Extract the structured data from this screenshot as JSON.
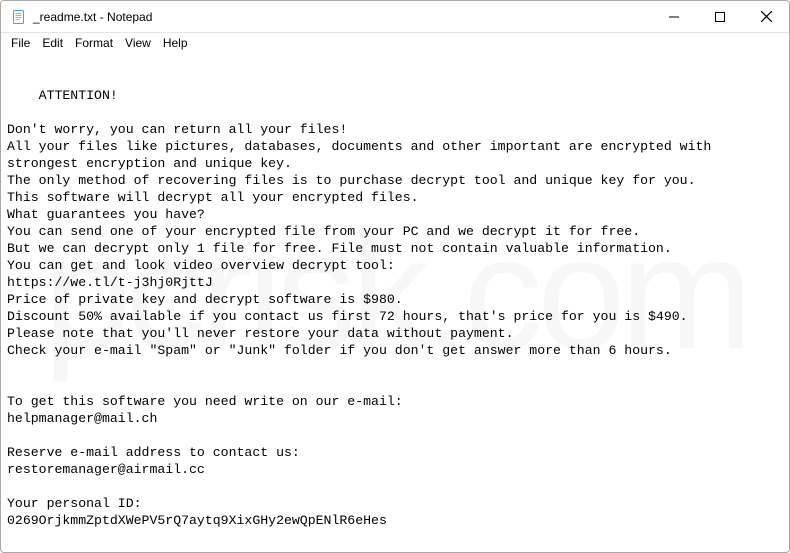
{
  "window": {
    "title": "_readme.txt - Notepad"
  },
  "menu": {
    "file": "File",
    "edit": "Edit",
    "format": "Format",
    "view": "View",
    "help": "Help"
  },
  "body": {
    "text": "ATTENTION!\n\nDon't worry, you can return all your files!\nAll your files like pictures, databases, documents and other important are encrypted with strongest encryption and unique key.\nThe only method of recovering files is to purchase decrypt tool and unique key for you.\nThis software will decrypt all your encrypted files.\nWhat guarantees you have?\nYou can send one of your encrypted file from your PC and we decrypt it for free.\nBut we can decrypt only 1 file for free. File must not contain valuable information.\nYou can get and look video overview decrypt tool:\nhttps://we.tl/t-j3hj0RjttJ\nPrice of private key and decrypt software is $980.\nDiscount 50% available if you contact us first 72 hours, that's price for you is $490.\nPlease note that you'll never restore your data without payment.\nCheck your e-mail \"Spam\" or \"Junk\" folder if you don't get answer more than 6 hours.\n\n\nTo get this software you need write on our e-mail:\nhelpmanager@mail.ch\n\nReserve e-mail address to contact us:\nrestoremanager@airmail.cc\n\nYour personal ID:\n0269OrjkmmZptdXWePV5rQ7aytq9XixGHy2ewQpENlR6eHes"
  },
  "watermark": {
    "text": "pcrisk.com"
  }
}
